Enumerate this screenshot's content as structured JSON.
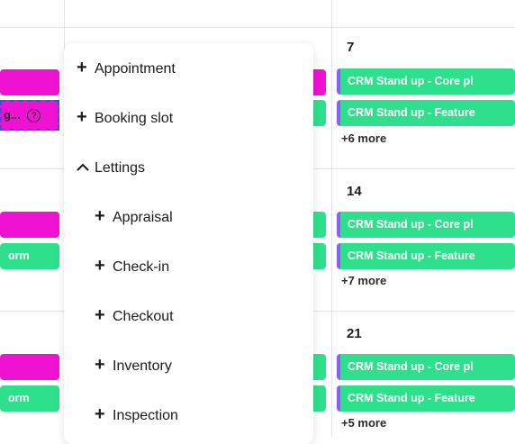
{
  "calendar": {
    "days": [
      {
        "num": "7",
        "events": [
          "CRM Stand up - Core pl",
          "CRM Stand up - Feature"
        ],
        "more": "+6 more"
      },
      {
        "num": "14",
        "events": [
          "CRM Stand up - Core pl",
          "CRM Stand up - Feature"
        ],
        "more": "+7 more"
      },
      {
        "num": "21",
        "events": [
          "CRM Stand up - Core pl",
          "CRM Stand up - Feature"
        ],
        "more": "+5 more"
      }
    ],
    "left_column": {
      "selected_event_text": "g...",
      "selected_event_icon": "?",
      "row2_event_text": "orm",
      "row3_event_text": "orm"
    }
  },
  "menu": {
    "items": [
      {
        "icon": "+",
        "label": "Appointment"
      },
      {
        "icon": "+",
        "label": "Booking slot"
      },
      {
        "icon": "^",
        "label": "Lettings"
      },
      {
        "icon": "+",
        "label": "Appraisal"
      },
      {
        "icon": "+",
        "label": "Check-in"
      },
      {
        "icon": "+",
        "label": "Checkout"
      },
      {
        "icon": "+",
        "label": "Inventory"
      },
      {
        "icon": "+",
        "label": "Inspection"
      }
    ]
  },
  "colors": {
    "event_green": "#2ee08c",
    "event_pink": "#f012d2",
    "event_accent_purple": "#8f5cf5",
    "selection_border": "#3b4fe0"
  }
}
